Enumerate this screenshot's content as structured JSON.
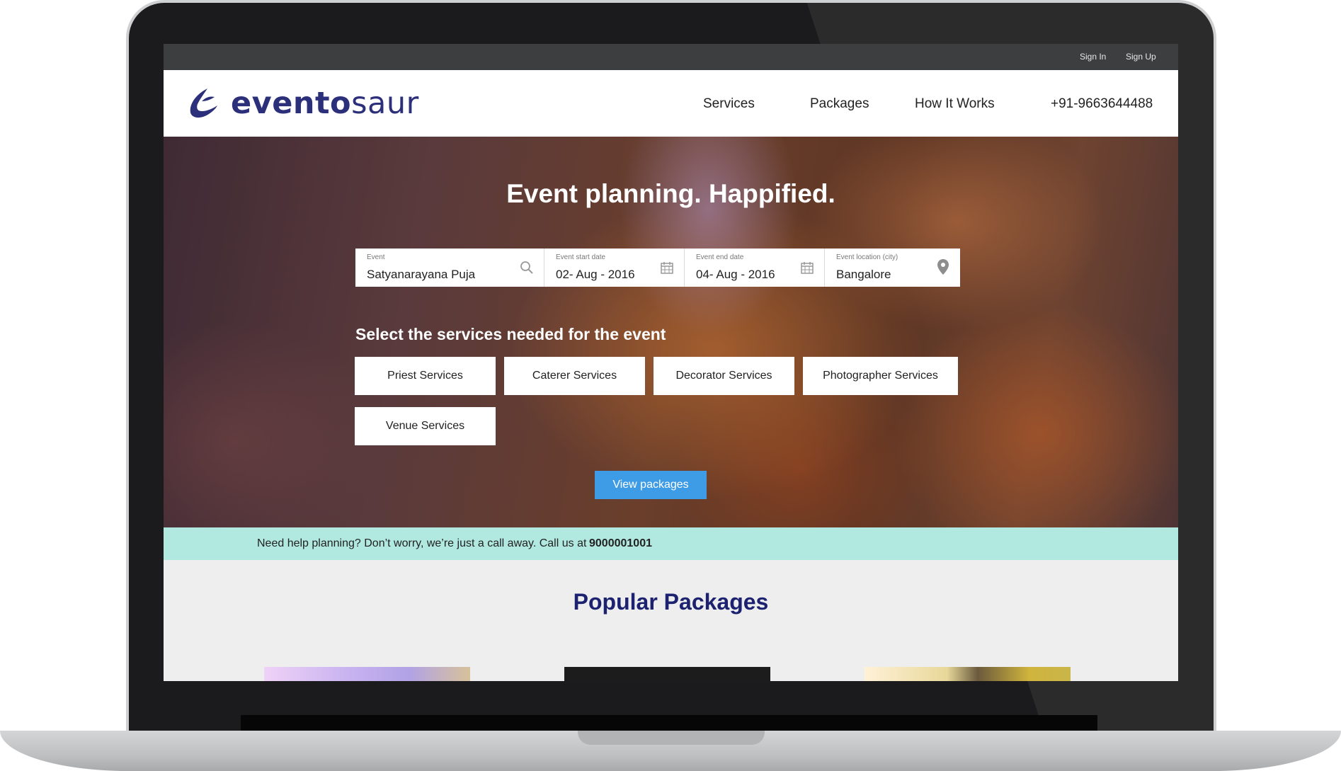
{
  "topbar": {
    "sign_in": "Sign In",
    "sign_up": "Sign Up"
  },
  "header": {
    "logo_bold": "evento",
    "logo_light": "saur",
    "nav": {
      "services": "Services",
      "packages": "Packages",
      "how_it_works": "How It Works",
      "phone": "+91-9663644488"
    }
  },
  "hero": {
    "title": "Event planning. Happified.",
    "search": {
      "event": {
        "label": "Event",
        "value": "Satyanarayana Puja",
        "icon": "search-icon"
      },
      "start": {
        "label": "Event start date",
        "value": "02- Aug - 2016",
        "icon": "calendar-icon"
      },
      "end": {
        "label": "Event end date",
        "value": "04- Aug - 2016",
        "icon": "calendar-icon"
      },
      "location": {
        "label": "Event location (city)",
        "value": "Bangalore",
        "icon": "location-pin-icon"
      }
    },
    "services_title": "Select the services needed for the event",
    "services": [
      "Priest Services",
      "Caterer Services",
      "Decorator Services",
      "Photographer Services",
      "Venue Services"
    ],
    "view_packages": "View packages"
  },
  "help": {
    "text": "Need help planning? Don’t worry, we’re just a call away. Call us at",
    "phone": "9000001001"
  },
  "popular": {
    "title": "Popular Packages"
  },
  "colors": {
    "brand": "#2c2f7a",
    "accent": "#3e9be6",
    "help_bg": "#b1e9e1",
    "heading": "#1c2270"
  }
}
